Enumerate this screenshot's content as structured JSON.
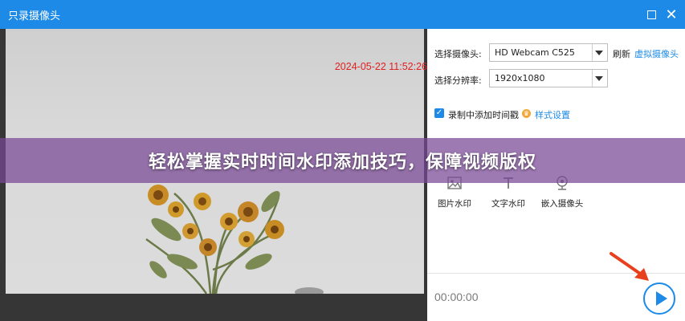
{
  "window": {
    "title": "只录摄像头",
    "max_icon": "maximize-icon",
    "close_glyph": "✕"
  },
  "preview": {
    "timestamp": "2024-05-22 11:52:26"
  },
  "settings": {
    "camera_label": "选择摄像头:",
    "camera_value": "HD Webcam C525",
    "refresh": "刷新",
    "virtual_camera": "虚拟摄像头",
    "resolution_label": "选择分辨率:",
    "resolution_value": "1920x1080",
    "timestamp_checkbox": "录制中添加时间戳",
    "style_settings": "样式设置"
  },
  "scene": {
    "tools": [
      {
        "label": "图片水印",
        "icon": "image-icon"
      },
      {
        "label": "文字水印",
        "icon": "text-icon"
      },
      {
        "label": "嵌入摄像头",
        "icon": "webcam-icon"
      }
    ]
  },
  "footer": {
    "time": "00:00:00",
    "play_icon": "play-icon"
  },
  "banner": {
    "text": "轻松掌握实时时间水印添加技巧，保障视频版权"
  },
  "colors": {
    "accent": "#1c8ae6",
    "timestamp": "#e02020",
    "banner": "#78469a",
    "arrow": "#e8401c"
  }
}
